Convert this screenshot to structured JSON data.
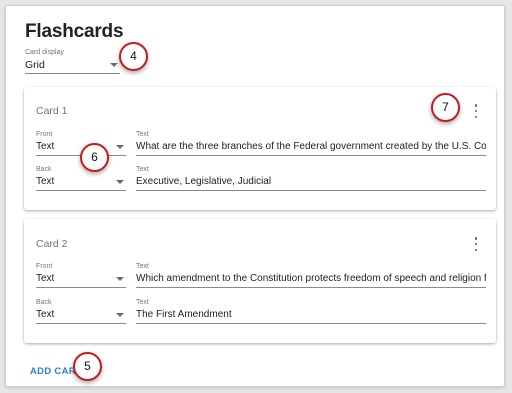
{
  "page": {
    "title": "Flashcards"
  },
  "display": {
    "label": "Card display",
    "value": "Grid"
  },
  "cards": [
    {
      "title": "Card 1",
      "front": {
        "type_label": "Front",
        "type_value": "Text",
        "text_label": "Text",
        "text_value": "What are the three branches of the Federal government created by the U.S. Constitution"
      },
      "back": {
        "type_label": "Back",
        "type_value": "Text",
        "text_label": "Text",
        "text_value": "Executive, Legislative, Judicial"
      }
    },
    {
      "title": "Card 2",
      "front": {
        "type_label": "Front",
        "type_value": "Text",
        "text_label": "Text",
        "text_value": "Which amendment to the Constitution protects freedom of speech and religion from governm"
      },
      "back": {
        "type_label": "Back",
        "type_value": "Text",
        "text_label": "Text",
        "text_value": "The First Amendment"
      }
    }
  ],
  "actions": {
    "add_card": "ADD CARD"
  },
  "callouts": [
    "4",
    "5",
    "6",
    "7"
  ],
  "colors": {
    "accent": "#2f80d1",
    "callout_border": "#c41c1c"
  },
  "icons": {
    "menu": "more-vert-icon",
    "dropdown": "arrow-drop-down-icon"
  }
}
